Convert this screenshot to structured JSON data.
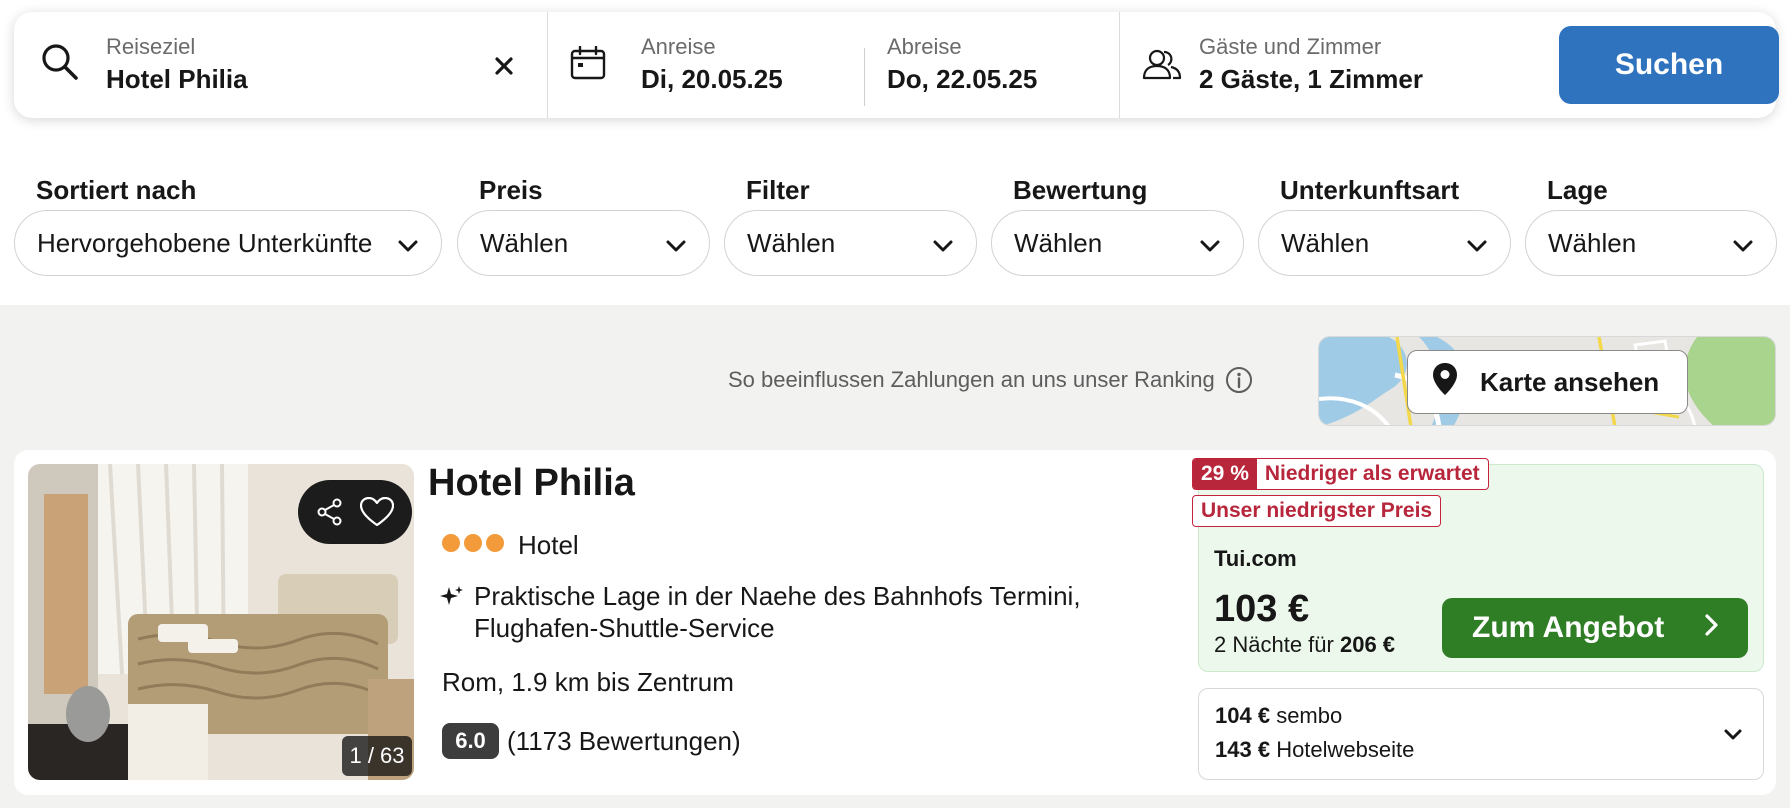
{
  "search": {
    "destination_label": "Reiseziel",
    "destination_value": "Hotel Philia",
    "checkin_label": "Anreise",
    "checkin_value": "Di, 20.05.25",
    "checkout_label": "Abreise",
    "checkout_value": "Do, 22.05.25",
    "guests_label": "Gäste und Zimmer",
    "guests_value": "2 Gäste, 1 Zimmer",
    "search_button": "Suchen"
  },
  "filters": [
    {
      "label": "Sortiert nach",
      "value": "Hervorgehobene Unterkünfte"
    },
    {
      "label": "Preis",
      "value": "Wählen"
    },
    {
      "label": "Filter",
      "value": "Wählen"
    },
    {
      "label": "Bewertung",
      "value": "Wählen"
    },
    {
      "label": "Unterkunftsart",
      "value": "Wählen"
    },
    {
      "label": "Lage",
      "value": "Wählen"
    }
  ],
  "ranking_text": "So beeinflussen Zahlungen an uns unser Ranking",
  "map_button": "Karte ansehen",
  "hotel": {
    "name": "Hotel Philia",
    "star_count": 3,
    "type": "Hotel",
    "feature": "Praktische Lage in der Naehe des Bahnhofs Termini, Flughafen-Shuttle-Service",
    "location": "Rom, 1.9 km bis Zentrum",
    "rating": "6.0",
    "reviews": "(1173 Bewertungen)",
    "photo_counter": "1 / 63"
  },
  "deal": {
    "discount_pct": "29 %",
    "discount_text": "Niedriger als erwartet",
    "lowest_tag": "Unser niedrigster Preis",
    "provider": "Tui.com",
    "price": "103 €",
    "nights_prefix": "2 Nächte für",
    "nights_total": "206 €",
    "offer_button": "Zum Angebot"
  },
  "alternatives": [
    {
      "price": "104 €",
      "provider": "sembo"
    },
    {
      "price": "143 €",
      "provider": "Hotelwebseite"
    }
  ],
  "colors": {
    "search_button": "#2f73bf",
    "offer_button": "#2f7d25",
    "discount_red": "#b8263c",
    "deal_bg": "#ecf8ec",
    "star_orange": "#f39a3a"
  }
}
